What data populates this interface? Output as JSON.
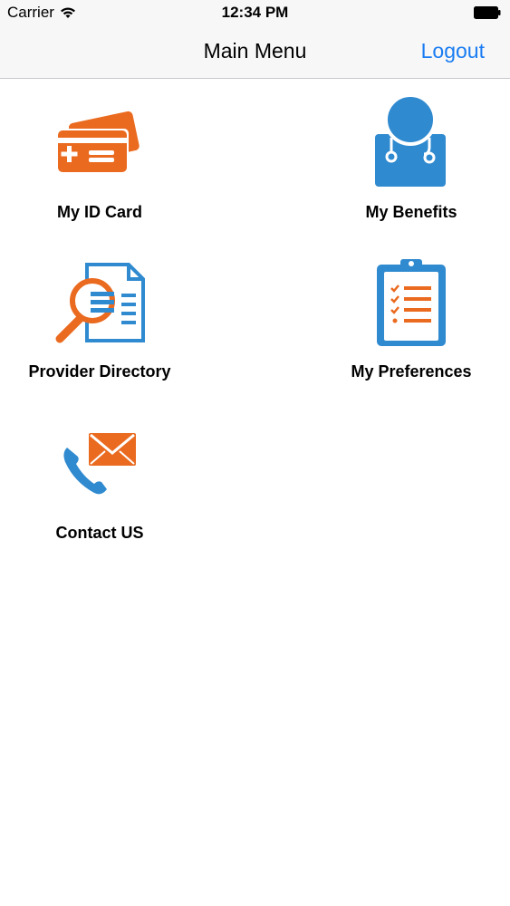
{
  "status_bar": {
    "carrier": "Carrier",
    "time": "12:34 PM"
  },
  "nav": {
    "title": "Main Menu",
    "logout_label": "Logout"
  },
  "menu": {
    "items": [
      {
        "label": "My ID Card",
        "icon": "id-card-icon"
      },
      {
        "label": "My Benefits",
        "icon": "doctor-icon"
      },
      {
        "label": "Provider Directory",
        "icon": "magnifier-document-icon"
      },
      {
        "label": "My Preferences",
        "icon": "clipboard-checklist-icon"
      },
      {
        "label": "Contact US",
        "icon": "phone-envelope-icon"
      }
    ]
  },
  "colors": {
    "orange": "#ea6a1f",
    "blue": "#2f8ad0",
    "link": "#1a7cf2"
  }
}
